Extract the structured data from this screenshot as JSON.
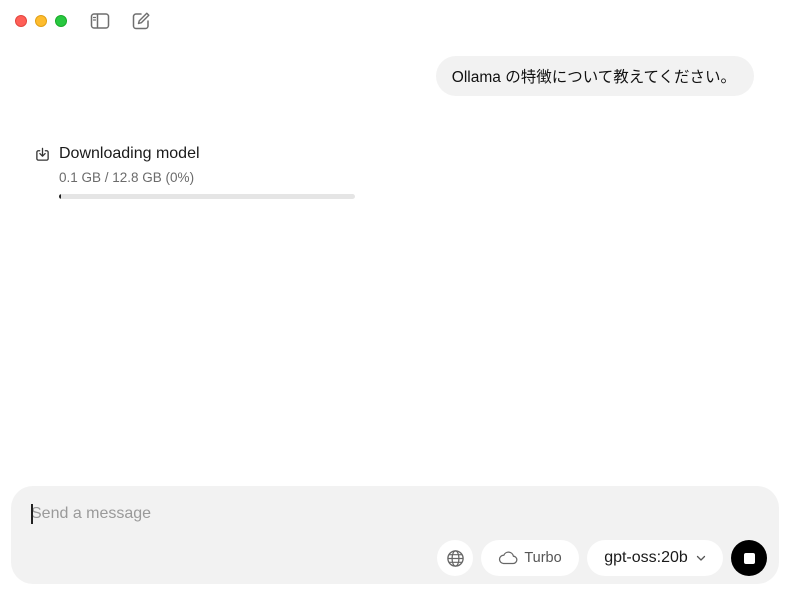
{
  "window": {
    "controls": [
      "close",
      "minimize",
      "maximize"
    ],
    "toolbar_icons": [
      "sidebar-toggle-icon",
      "new-chat-icon"
    ]
  },
  "chat": {
    "user_message": "Ollama の特徴について教えてください。"
  },
  "download": {
    "icon": "download-icon",
    "title": "Downloading model",
    "progress_text": "0.1 GB / 12.8 GB (0%)",
    "progress_fraction": 0.008
  },
  "composer": {
    "placeholder": "Send a message",
    "value": "",
    "web_search_icon": "globe-icon",
    "turbo_label": "Turbo",
    "turbo_icon": "cloud-icon",
    "model_label": "gpt-oss:20b",
    "model_icon": "chevron-down-icon",
    "stop_icon": "stop-icon"
  },
  "colors": {
    "close": "#ff5f57",
    "minimize": "#febc2e",
    "maximize": "#28c840",
    "bubble_bg": "#f2f2f2",
    "composer_bg": "#f2f2f2",
    "stop_bg": "#000000"
  }
}
